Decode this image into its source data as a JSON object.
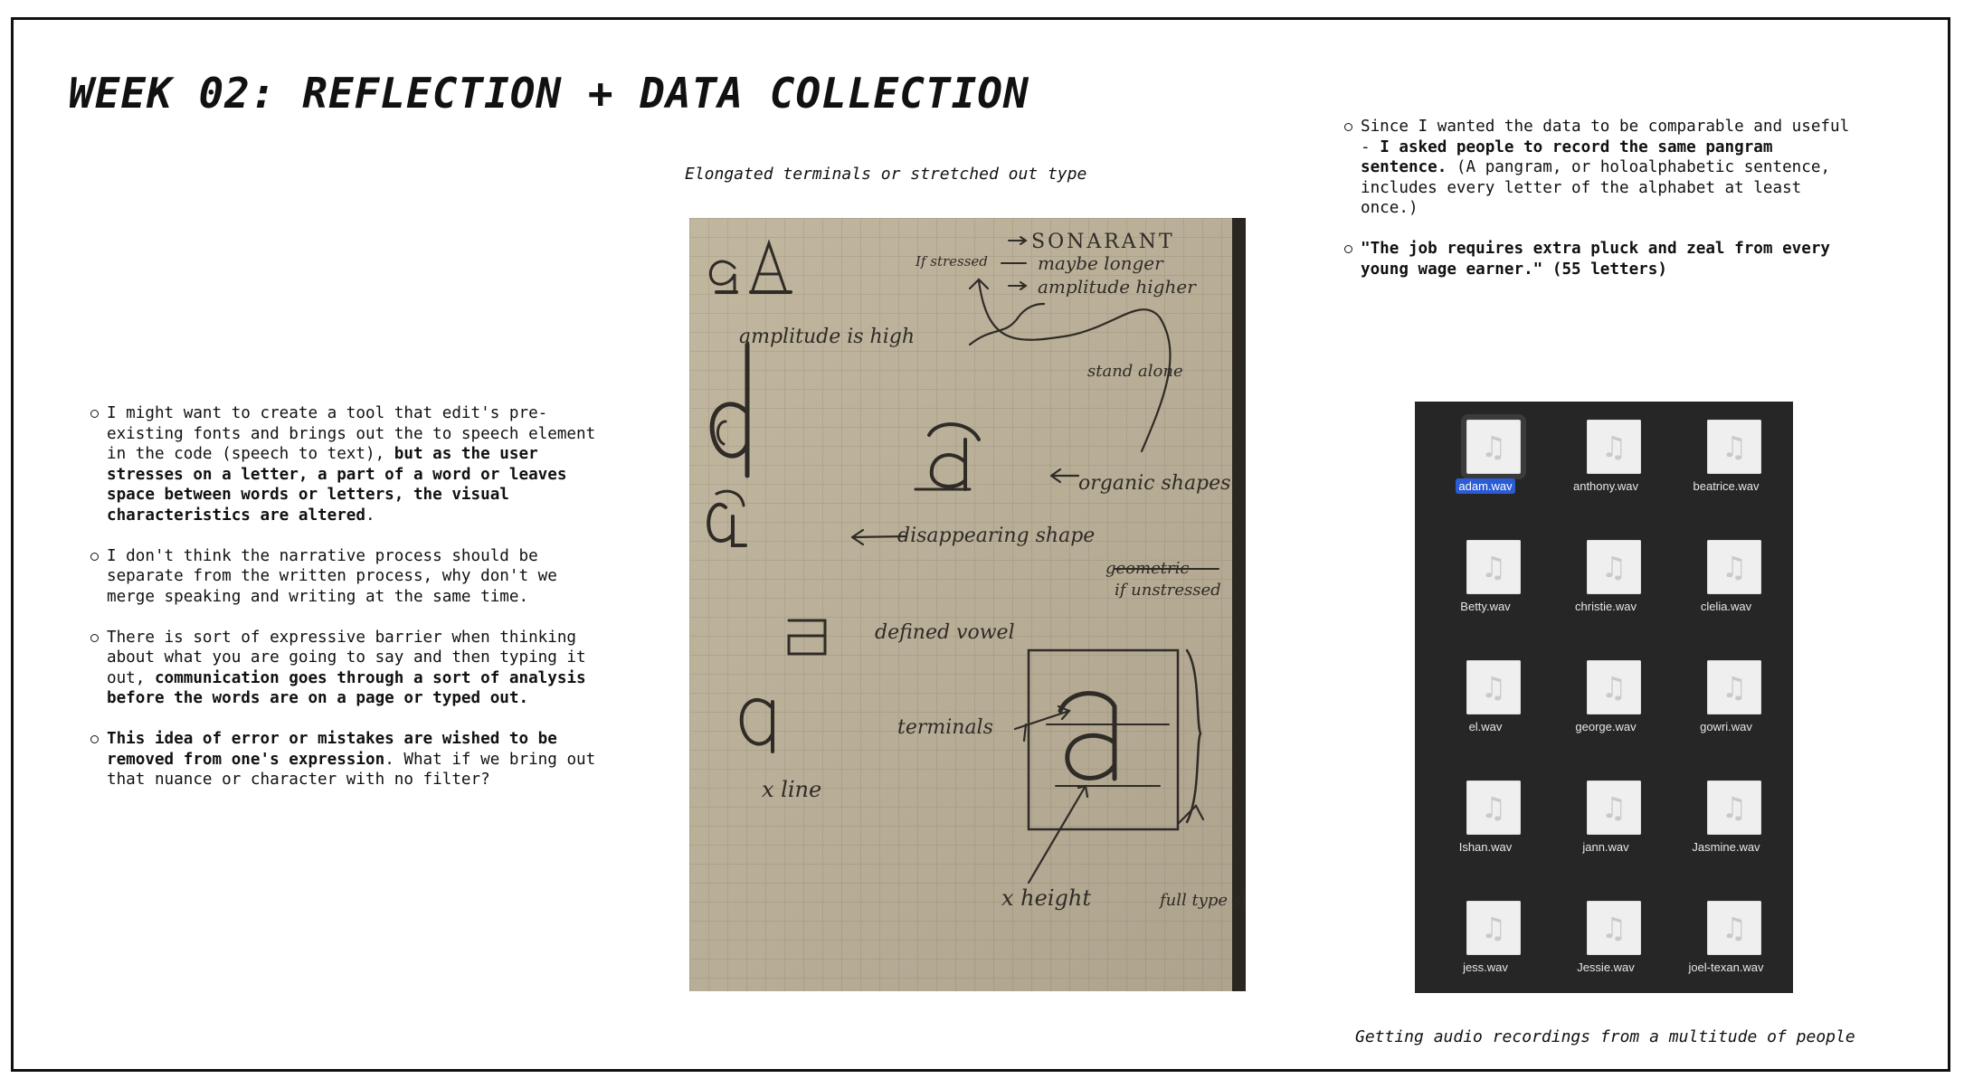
{
  "title": "WEEK 02: REFLECTION + DATA COLLECTION",
  "left_bullets": {
    "b1": {
      "t1": "I might want to create a tool that edit's pre-existing fonts and brings out the to speech element in the code (speech to text), ",
      "b1": "but as the user stresses on a letter, a part of a word or leaves space between words or letters, the visual characteristics are altered",
      "t2": "."
    },
    "b2": {
      "t1": "I don't think the narrative process should be separate from the written process, why don't we merge speaking and writing at the same time."
    },
    "b3": {
      "t1": " There is sort of expressive barrier when thinking about what you are going to say and then typing it out, ",
      "b1": "communication goes through a sort of analysis before the words are on a page or typed out."
    },
    "b4": {
      "b1": "This idea of error or mistakes are wished to be removed from one's expression",
      "t1": ". What if we bring out that nuance or character with no filter?"
    }
  },
  "right_bullets": {
    "b1": {
      "t1": "Since I wanted the data to be comparable and useful - ",
      "b1": "I asked people to record the same pangram sentence.",
      "t2": " (A pangram, or holoalphabetic sentence, includes every letter of the alphabet at least once.)"
    },
    "b2": {
      "b1": "\"The job requires extra pluck and zeal from every young wage earner.\" (55 letters)"
    }
  },
  "sketch": {
    "caption": "Elongated terminals or stretched out type",
    "annotations": {
      "sonarant": "SONARANT",
      "if_stressed": "If stressed",
      "maybe_longer": "maybe longer",
      "amplitude_higher": "amplitude higher",
      "amplitude_is_high": "amplitude is high",
      "stand_alone": "stand alone",
      "organic_shapes": "organic shapes",
      "disappearing_shape": "disappearing shape",
      "geometric": "geometric",
      "if_unstressed": "if unstressed",
      "defined_vowel": "defined vowel",
      "terminals": "terminals",
      "x_line": "x line",
      "x_height": "x height",
      "full_type_size": "full type size"
    }
  },
  "audio": {
    "caption": "Getting audio recordings from a multitude of people",
    "files": [
      "adam.wav",
      "anthony.wav",
      "beatrice.wav",
      "Betty.wav",
      "christie.wav",
      "clelia.wav",
      "el.wav",
      "george.wav",
      "gowri.wav",
      "Ishan.wav",
      "jann.wav",
      "Jasmine.wav",
      "jess.wav",
      "Jessie.wav",
      "joel-texan.wav"
    ],
    "selected": "adam.wav"
  }
}
